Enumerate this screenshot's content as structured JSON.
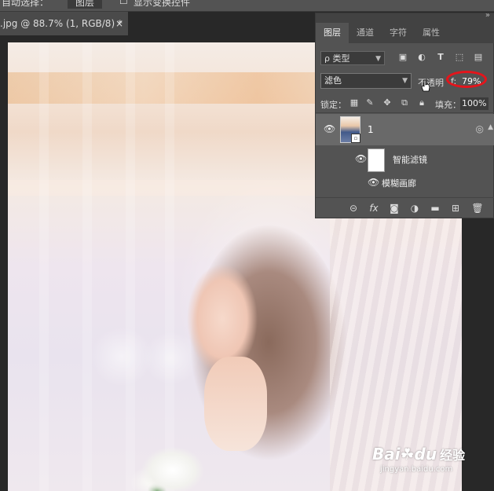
{
  "options_bar": {
    "auto_select_label": "自动选择：",
    "auto_select_value": "图层",
    "show_transform": "显示变换控件"
  },
  "document_tab": {
    "title": ".jpg @ 88.7% (1, RGB/8) *",
    "close": "×"
  },
  "layers_panel": {
    "collapse_glyph": "»",
    "tabs": [
      {
        "label": "图层",
        "active": true
      },
      {
        "label": "通道",
        "active": false
      },
      {
        "label": "字符",
        "active": false
      },
      {
        "label": "属性",
        "active": false
      }
    ],
    "filter": {
      "search_glyph": "ρ",
      "kind_label": "类型",
      "icons": [
        "image-filter-icon",
        "adjustment-filter-icon",
        "type-filter-icon",
        "shape-filter-icon",
        "smartobject-filter-icon"
      ]
    },
    "blend_mode": "滤色",
    "opacity_label": "不透明",
    "opacity_suffix": "f:",
    "opacity_value": "79%",
    "lock_label": "锁定：",
    "fill_label": "填充：",
    "fill_value": "100%",
    "layer": {
      "name": "1"
    },
    "smart_filter_label": "智能滤镜",
    "blur_filter_label": "模糊画廊",
    "bottom_icons": [
      "link-icon",
      "fx-icon",
      "mask-icon",
      "adjustment-icon",
      "group-folder-icon",
      "new-layer-icon",
      "trash-icon"
    ],
    "bottom_fx_text": "fx"
  },
  "annotation": {
    "highlight_color": "#e5141b"
  },
  "watermark": {
    "logo": "Bai",
    "logo_du": "du",
    "jingyan": "经验",
    "url": "jingyan.baidu.com"
  }
}
